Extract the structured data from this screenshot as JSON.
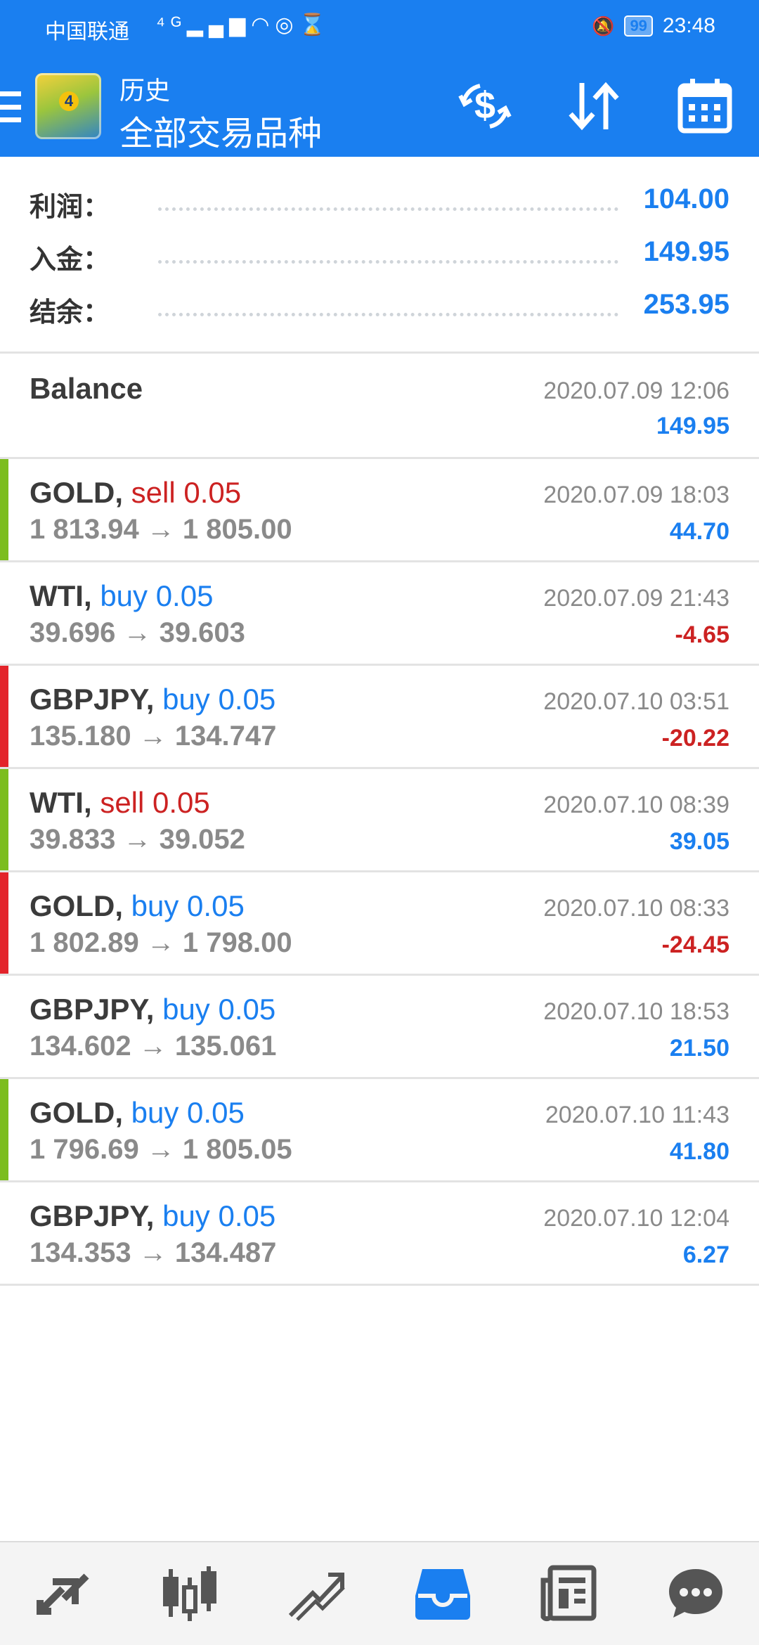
{
  "status_bar": {
    "carrier": "中国联通",
    "network": "⁴ᴳ",
    "battery": "99",
    "time": "23:48"
  },
  "header": {
    "title": "历史",
    "subtitle": "全部交易品种",
    "icons": [
      "menu-icon",
      "balance-filter-icon",
      "sort-icon",
      "calendar-icon"
    ],
    "accent_color": "#1a7ff0"
  },
  "summary": [
    {
      "label": "利润：",
      "value": "104.00"
    },
    {
      "label": "入金：",
      "value": "149.95"
    },
    {
      "label": "结余：",
      "value": "253.95"
    }
  ],
  "balance_entry": {
    "label": "Balance",
    "datetime": "2020.07.09 12:06",
    "amount": "149.95"
  },
  "trades": [
    {
      "symbol": "GOLD,",
      "side": "sell 0.05",
      "prices": "1 813.94 → 1 805.00",
      "datetime": "2020.07.09 18:03",
      "profit": "44.70"
    },
    {
      "symbol": "WTI,",
      "side": "buy 0.05",
      "prices": "39.696 → 39.603",
      "datetime": "2020.07.09 21:43",
      "profit": "-4.65"
    },
    {
      "symbol": "GBPJPY,",
      "side": "buy 0.05",
      "prices": "135.180 → 134.747",
      "datetime": "2020.07.10 03:51",
      "profit": "-20.22"
    },
    {
      "symbol": "WTI,",
      "side": "sell 0.05",
      "prices": "39.833 → 39.052",
      "datetime": "2020.07.10 08:39",
      "profit": "39.05"
    },
    {
      "symbol": "GOLD,",
      "side": "buy 0.05",
      "prices": "1 802.89 → 1 798.00",
      "datetime": "2020.07.10 08:33",
      "profit": "-24.45"
    },
    {
      "symbol": "GBPJPY,",
      "side": "buy 0.05",
      "prices": "134.602 → 135.061",
      "datetime": "2020.07.10 18:53",
      "profit": "21.50"
    },
    {
      "symbol": "GOLD,",
      "side": "buy 0.05",
      "prices": "1 796.69 → 1 805.05",
      "datetime": "2020.07.10 11:43",
      "profit": "41.80"
    },
    {
      "symbol": "GBPJPY,",
      "side": "buy 0.05",
      "prices": "134.353 → 134.487",
      "datetime": "2020.07.10 12:04",
      "profit": "6.27"
    }
  ],
  "bottom_nav": [
    "quotes-icon",
    "chart-icon",
    "trade-icon",
    "history-icon",
    "news-icon",
    "chat-icon"
  ],
  "colors": {
    "positive": "#1a7ff0",
    "negative": "#cc2222",
    "strip_green": "#7cbd1e",
    "strip_red": "#e3242b"
  }
}
